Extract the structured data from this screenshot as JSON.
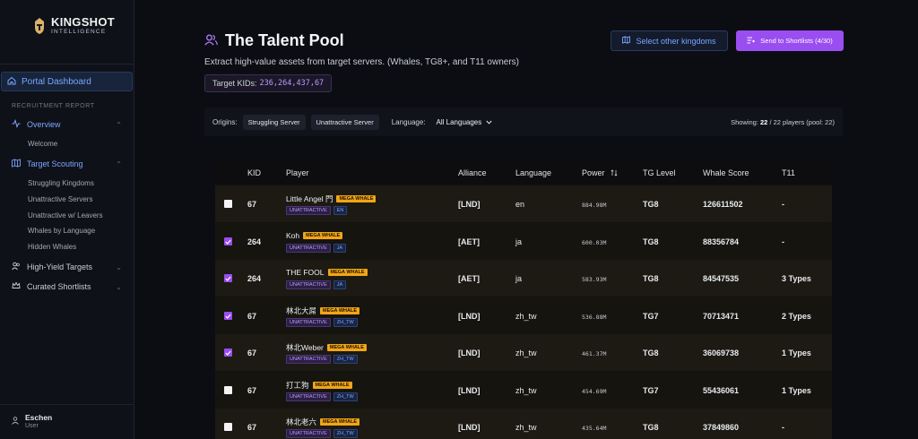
{
  "brand": {
    "title": "KINGSHOT",
    "subtitle": "INTELLIGENCE"
  },
  "sidebar": {
    "portal_label": "Portal Dashboard",
    "section_label": "RECRUITMENT REPORT",
    "overview": {
      "label": "Overview",
      "items": [
        "Welcome"
      ]
    },
    "target_scouting": {
      "label": "Target Scouting",
      "items": [
        "Struggling Kingdoms",
        "Unattractive Servers",
        "Unattractive w/ Leavers",
        "Whales by Language",
        "Hidden Whales"
      ]
    },
    "high_yield": "High-Yield Targets",
    "curated": "Curated Shortlists"
  },
  "user": {
    "name": "Eschen",
    "role": "User"
  },
  "header": {
    "title": "The Talent Pool",
    "subtitle": "Extract high-value assets from target servers. (Whales, TG8+, and T11 owners)",
    "target_kids_label": "Target KIDs:",
    "target_kids_value": "236,264,437,67",
    "select_kingdoms": "Select other kingdoms",
    "send_shortlists": "Send to Shortlists (4/30)"
  },
  "filters": {
    "origins_label": "Origins:",
    "origins": [
      "Struggling Server",
      "Unattractive Server"
    ],
    "language_label": "Language:",
    "language_value": "All Languages",
    "showing_label": "Showing:",
    "showing_count": "22",
    "showing_rest": "/ 22 players (pool: 22)"
  },
  "table": {
    "columns": [
      "KID",
      "Player",
      "Alliance",
      "Language",
      "Power",
      "TG Level",
      "Whale Score",
      "T11"
    ],
    "rows": [
      {
        "checked": false,
        "kid": "67",
        "player": "Little Angel 門",
        "badge": "MEGA WHALE",
        "tag": "UNATTRACTIVE",
        "lang_tag": "EN",
        "alliance": "[LND]",
        "language": "en",
        "power": "884.98M",
        "tg": "TG8",
        "score": "126611502",
        "t11": "-"
      },
      {
        "checked": true,
        "kid": "264",
        "player": "Koh",
        "badge": "MEGA WHALE",
        "tag": "UNATTRACTIVE",
        "lang_tag": "JA",
        "alliance": "[AET]",
        "language": "ja",
        "power": "600.03M",
        "tg": "TG8",
        "score": "88356784",
        "t11": "-"
      },
      {
        "checked": true,
        "kid": "264",
        "player": "THE FOOL",
        "badge": "MEGA WHALE",
        "tag": "UNATTRACTIVE",
        "lang_tag": "JA",
        "alliance": "[AET]",
        "language": "ja",
        "power": "583.93M",
        "tg": "TG8",
        "score": "84547535",
        "t11": "3 Types"
      },
      {
        "checked": true,
        "kid": "67",
        "player": "林北大屌",
        "badge": "MEGA WHALE",
        "tag": "UNATTRACTIVE",
        "lang_tag": "ZH_TW",
        "alliance": "[LND]",
        "language": "zh_tw",
        "power": "536.88M",
        "tg": "TG7",
        "score": "70713471",
        "t11": "2 Types"
      },
      {
        "checked": true,
        "kid": "67",
        "player": "林北Weber",
        "badge": "MEGA WHALE",
        "tag": "UNATTRACTIVE",
        "lang_tag": "ZH_TW",
        "alliance": "[LND]",
        "language": "zh_tw",
        "power": "461.37M",
        "tg": "TG8",
        "score": "36069738",
        "t11": "1 Types"
      },
      {
        "checked": false,
        "kid": "67",
        "player": "打工狗",
        "badge": "MEGA WHALE",
        "tag": "UNATTRACTIVE",
        "lang_tag": "ZH_TW",
        "alliance": "[LND]",
        "language": "zh_tw",
        "power": "454.69M",
        "tg": "TG7",
        "score": "55436061",
        "t11": "1 Types"
      },
      {
        "checked": false,
        "kid": "67",
        "player": "林北老六",
        "badge": "MEGA WHALE",
        "tag": "UNATTRACTIVE",
        "lang_tag": "ZH_TW",
        "alliance": "[LND]",
        "language": "zh_tw",
        "power": "435.64M",
        "tg": "TG8",
        "score": "37849860",
        "t11": "-"
      }
    ]
  },
  "colors": {
    "accent": "#9a4df0",
    "blue": "#7aa6ff",
    "mega": "#f2a516"
  }
}
